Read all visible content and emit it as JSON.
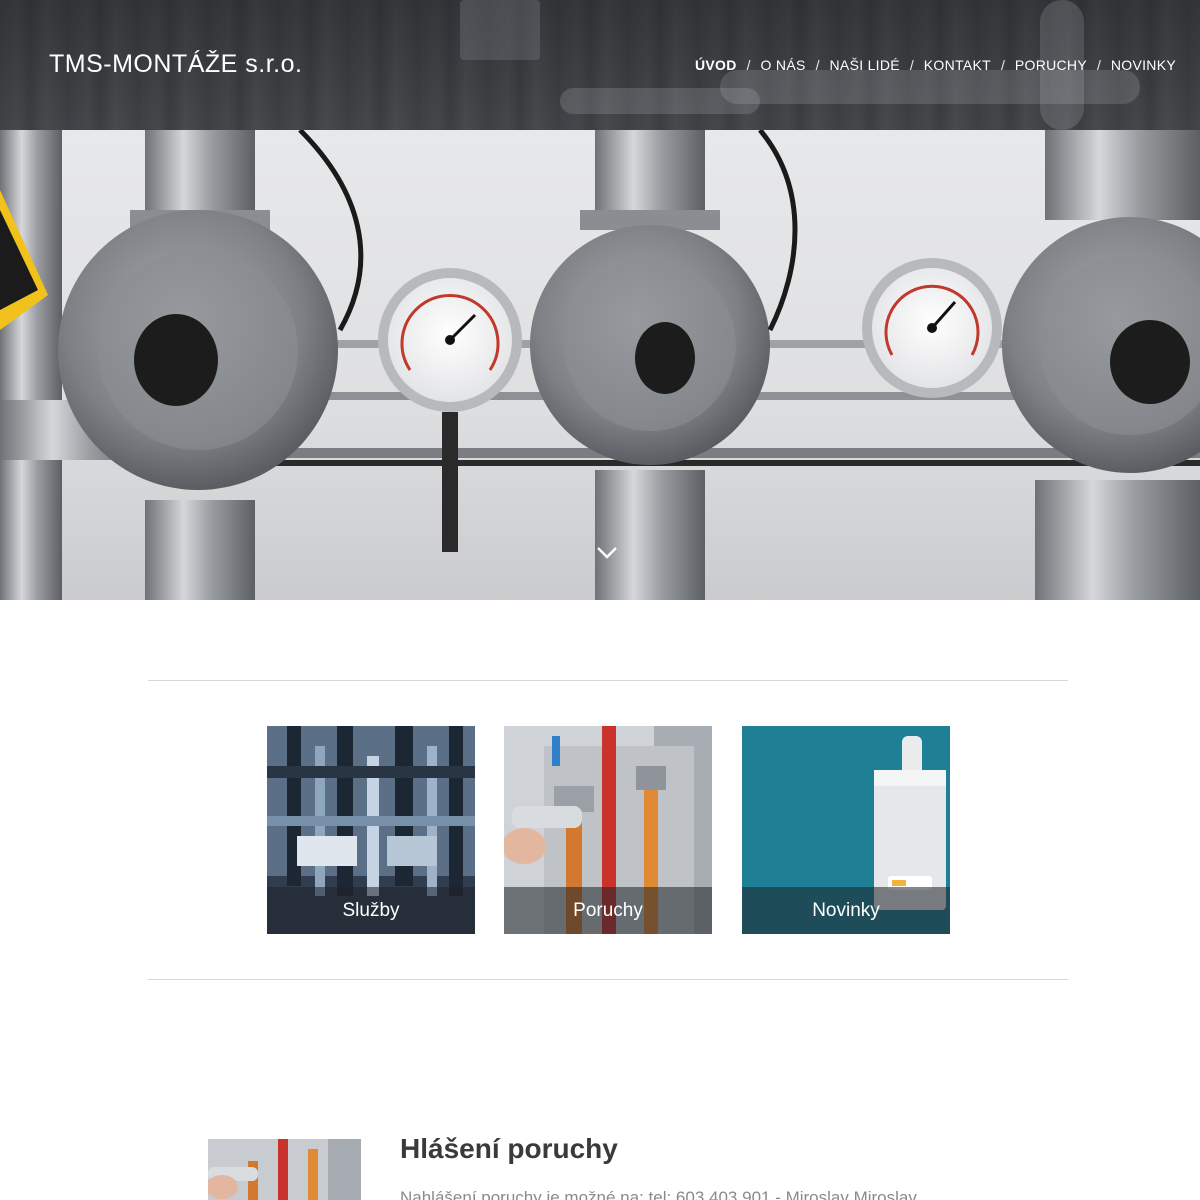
{
  "header": {
    "logo": "TMS-MONTÁŽE s.r.o.",
    "nav": [
      {
        "label": "ÚVOD",
        "active": true
      },
      {
        "label": "O NÁS",
        "active": false
      },
      {
        "label": "NAŠI LIDÉ",
        "active": false
      },
      {
        "label": "KONTAKT",
        "active": false
      },
      {
        "label": "PORUCHY",
        "active": false
      },
      {
        "label": "NOVINKY",
        "active": false
      }
    ],
    "separator": "/"
  },
  "hero": {
    "image": "pressure-regulators-and-gauges-photo",
    "scroll_icon": "chevron-down-icon"
  },
  "tiles": [
    {
      "label": "Služby",
      "image": "industrial-pipes-photo"
    },
    {
      "label": "Poruchy",
      "image": "wrench-on-pipes-photo"
    },
    {
      "label": "Novinky",
      "image": "boiler-on-teal-wall-photo"
    }
  ],
  "section": {
    "title": "Hlášení poruchy",
    "text": "Nahlášení poruchy je možné na: tel: 603 403 901 - Miroslav Miroslav"
  },
  "colors": {
    "header_overlay": "#2c2e32",
    "tile_caption_overlay": "#1e2228",
    "teal": "#1f7f95",
    "divider": "#d8d8d8"
  }
}
